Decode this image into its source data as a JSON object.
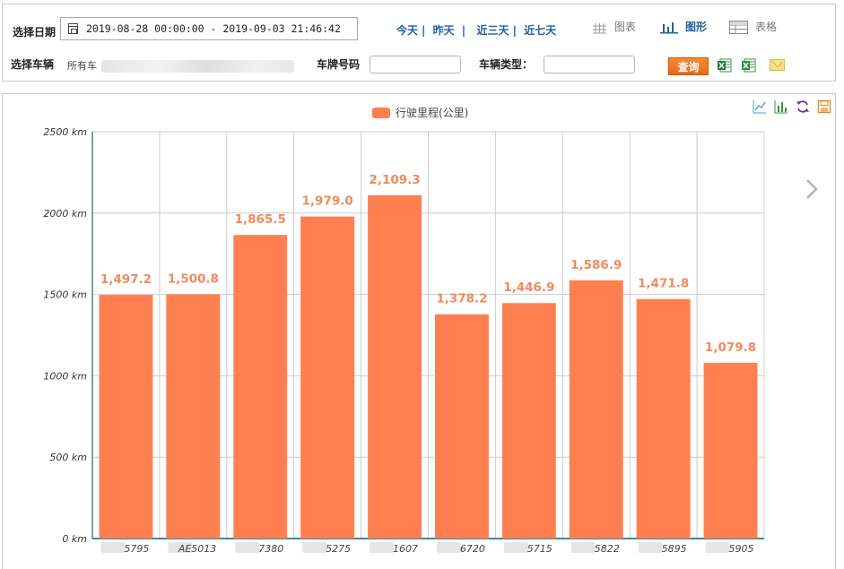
{
  "filter": {
    "date_label": "选择日期",
    "date_range": "2019-08-28 00:00:00 - 2019-09-03 21:46:42",
    "quick_ranges": [
      "今天",
      "昨天",
      "近三天",
      "近七天"
    ],
    "views": [
      {
        "label": "图表",
        "icon": "grid-chart-icon",
        "active": false
      },
      {
        "label": "图形",
        "icon": "bar-chart-icon",
        "active": true
      },
      {
        "label": "表格",
        "icon": "table-icon",
        "active": false
      }
    ],
    "vehicle_label": "选择车辆",
    "vehicle_value": "所有车",
    "plate_label": "车牌号码",
    "plate_value": "",
    "type_label": "车辆类型：",
    "type_value": "",
    "query_label": "查询",
    "export_icons": [
      "excel-export-icon",
      "excel-export-all-icon",
      "mail-icon"
    ]
  },
  "toolbar": {
    "icons": [
      "line-chart-icon",
      "bar-chart-icon",
      "refresh-icon",
      "save-icon"
    ]
  },
  "chart_data": {
    "type": "bar",
    "legend": "行驶里程(公里)",
    "legend_placement": "top-center",
    "categories": [
      "苏■■5795",
      "■AE5013",
      "■■■7380",
      "■■■5275",
      "■■■1607",
      "■■■6720",
      "■■■5715",
      "■■■5822",
      "■■■5895",
      "■■■5905"
    ],
    "visible_category_text": [
      "5795",
      "AE5013",
      "7380",
      "5275",
      "1607",
      "6720",
      "5715",
      "5822",
      "5895",
      "5905"
    ],
    "values": [
      1497.2,
      1500.8,
      1865.5,
      1979.0,
      2109.3,
      1378.2,
      1446.9,
      1586.9,
      1471.8,
      1079.8
    ],
    "value_labels": [
      "1,497.2",
      "1,500.8",
      "1,865.5",
      "1,979.0",
      "2,109.3",
      "1,378.2",
      "1,446.9",
      "1,586.9",
      "1,471.8",
      "1,079.8"
    ],
    "y_ticks": [
      "0 km",
      "500 km",
      "1000 km",
      "1500 km",
      "2000 km",
      "2500 km"
    ],
    "ylim": [
      0,
      2500
    ],
    "grid": true,
    "color": "#ff7f50",
    "label_color": "#f08a5d"
  }
}
